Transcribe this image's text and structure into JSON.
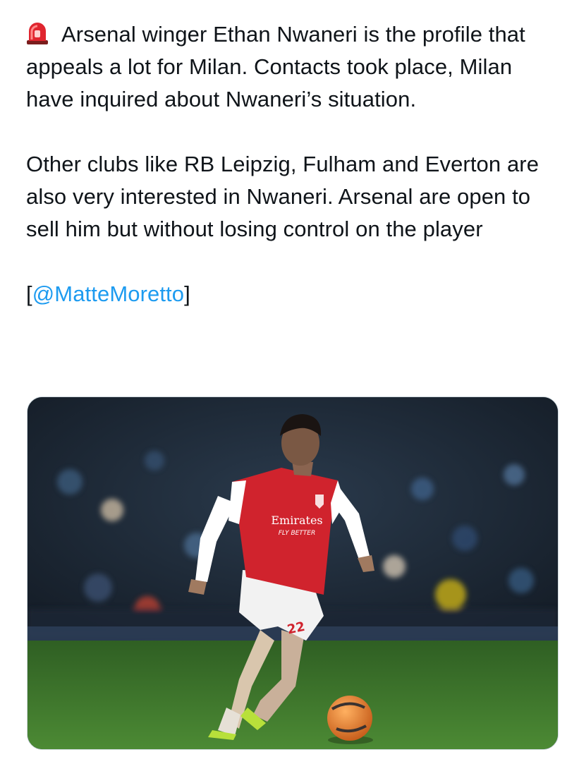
{
  "tweet": {
    "siren_icon": "rotating-light-icon",
    "para1": "Arsenal winger Ethan Nwaneri is the profile that appeals a lot for Milan. Contacts took place, Milan have inquired about Nwaneri’s situation.",
    "para2": "Other clubs like RB Leipzig, Fulham and Everton are also very interested in Nwaneri. Arsenal are open to sell him but without losing control on the player",
    "source_open": "[",
    "source_handle": "@MatteMoretto",
    "source_close": "]"
  },
  "media": {
    "sponsor_line1": "Emirates",
    "sponsor_line2": "FLY BETTER",
    "shirt_number": "22"
  },
  "colors": {
    "text": "#0f1419",
    "link": "#1d9bf0",
    "kit_red": "#d0232d",
    "pitch": "#3e7a2e"
  }
}
